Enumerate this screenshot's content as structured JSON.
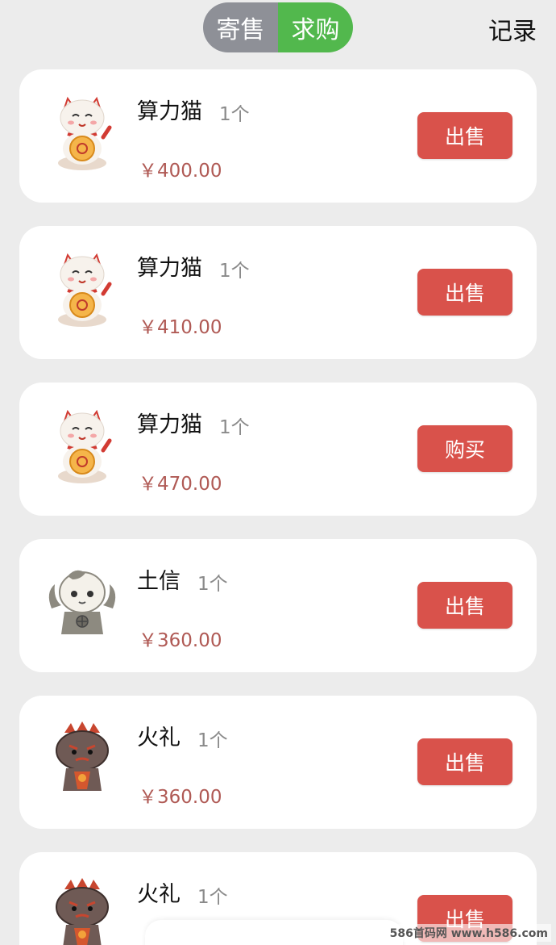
{
  "header": {
    "tab_sell": "寄售",
    "tab_buy": "求购",
    "records": "记录"
  },
  "items": [
    {
      "name": "算力猫",
      "qty": "1个",
      "price": "￥400.00",
      "action": "出售",
      "icon": "lucky-cat-icon"
    },
    {
      "name": "算力猫",
      "qty": "1个",
      "price": "￥410.00",
      "action": "出售",
      "icon": "lucky-cat-icon"
    },
    {
      "name": "算力猫",
      "qty": "1个",
      "price": "￥470.00",
      "action": "购买",
      "icon": "lucky-cat-icon"
    },
    {
      "name": "土信",
      "qty": "1个",
      "price": "￥360.00",
      "action": "出售",
      "icon": "earth-cat-icon"
    },
    {
      "name": "火礼",
      "qty": "1个",
      "price": "￥360.00",
      "action": "出售",
      "icon": "fire-cat-icon"
    },
    {
      "name": "火礼",
      "qty": "1个",
      "price": "￥",
      "action": "出售",
      "icon": "fire-cat-icon"
    }
  ],
  "watermark": "586首码网 www.h586.com",
  "colors": {
    "background": "#ececec",
    "segment_inactive": "#8e9097",
    "segment_active": "#52b84d",
    "action_button": "#d9524b",
    "price_text": "#b05a55"
  }
}
